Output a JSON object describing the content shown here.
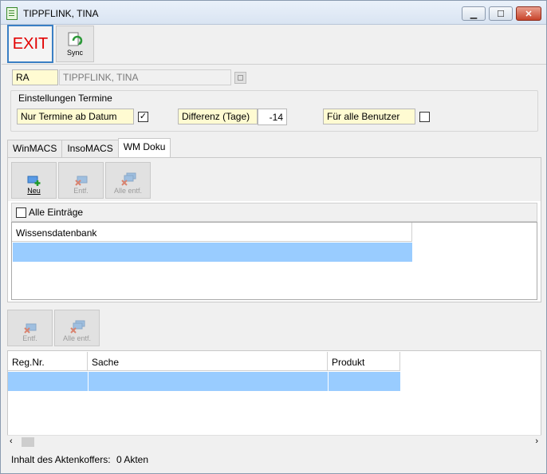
{
  "window": {
    "title": "TIPPFLINK, TINA",
    "controls": {
      "minimize": "▁",
      "maximize": "☐",
      "close": "✕"
    }
  },
  "toolbar": {
    "exit_label": "EXIT",
    "sync_label": "Sync"
  },
  "header": {
    "code": "RA",
    "name": "TIPPFLINK, TINA"
  },
  "settings": {
    "group_label": "Einstellungen Termine",
    "nur_termine_label": "Nur Termine ab Datum",
    "nur_termine_checked": true,
    "differenz_label": "Differenz (Tage)",
    "differenz_value": "-14",
    "fuer_alle_label": "Für alle Benutzer",
    "fuer_alle_checked": false
  },
  "tabs": [
    {
      "label": "WinMACS",
      "active": false
    },
    {
      "label": "InsoMACS",
      "active": false
    },
    {
      "label": "WM Doku",
      "active": true
    }
  ],
  "tab_toolbar": {
    "neu": "Neu",
    "entf": "Entf.",
    "alle_entf": "Alle entf."
  },
  "alle_eintraege": {
    "label": "Alle Einträge",
    "checked": false
  },
  "wissens_grid": {
    "column": "Wissensdatenbank"
  },
  "lower_toolbar": {
    "entf": "Entf.",
    "alle_entf": "Alle entf."
  },
  "akten_grid": {
    "columns": [
      "Reg.Nr.",
      "Sache",
      "Produkt"
    ]
  },
  "status": {
    "label": "Inhalt des Aktenkoffers:",
    "value": "0 Akten"
  },
  "colors": {
    "selection": "#99ccff",
    "field_yellow": "#fffbd2",
    "exit_red": "#e20000"
  }
}
